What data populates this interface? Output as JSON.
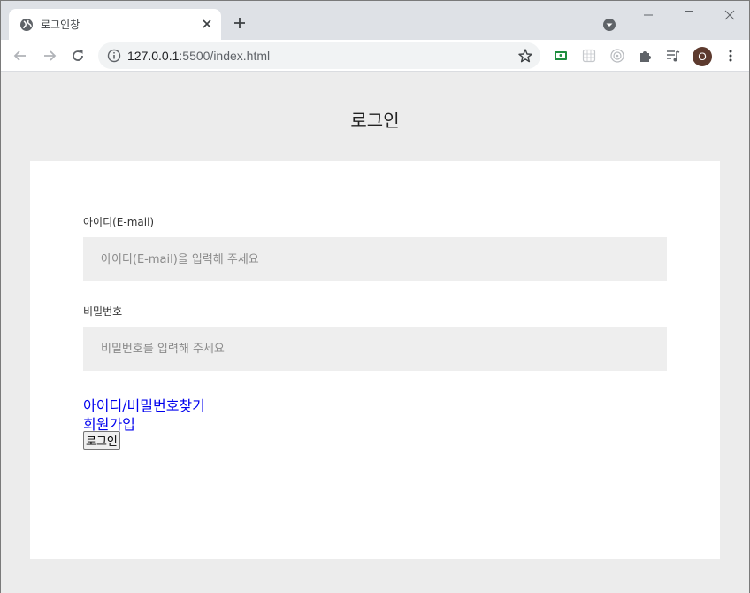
{
  "browser": {
    "tab": {
      "title": "로그인창"
    },
    "address": {
      "host": "127.0.0.1",
      "path": ":5500/index.html"
    },
    "avatar_initial": "O"
  },
  "page": {
    "title": "로그인",
    "form": {
      "id_label": "아이디(E-mail)",
      "id_placeholder": "아이디(E-mail)을 입력해 주세요",
      "pw_label": "비밀번호",
      "pw_placeholder": "비밀번호를 입력해 주세요",
      "find_link": "아이디/비밀번호찾기",
      "signup_link": "회원가입",
      "login_button": "로그인"
    }
  },
  "colors": {
    "link": "#0000ee",
    "input_bg": "#eeeeee",
    "page_bg": "#ececec",
    "card_bg": "#ffffff"
  }
}
